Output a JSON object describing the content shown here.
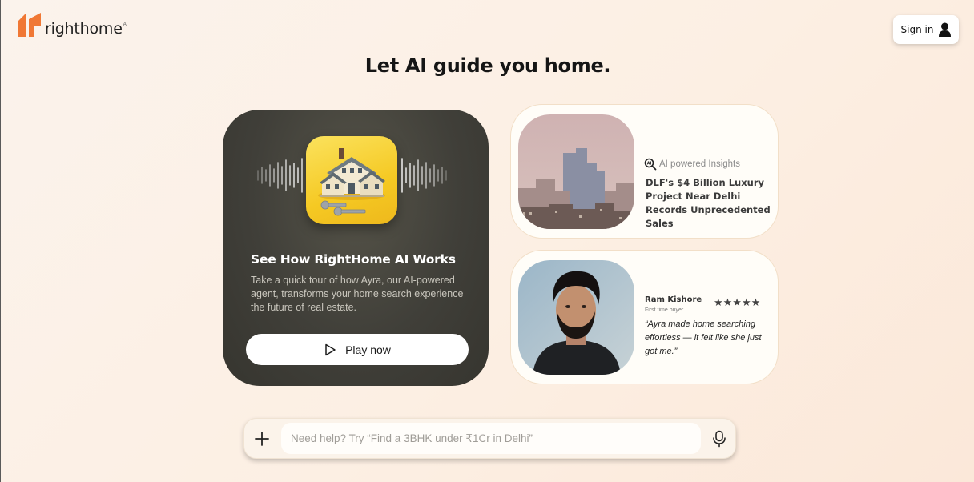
{
  "brand": {
    "name": "righthome",
    "tm": "AI",
    "logo_icon": "righthome-logo-icon",
    "accent": "#f07835"
  },
  "header": {
    "signin_label": "Sign in",
    "signin_icon": "user-icon"
  },
  "hero": {
    "headline": "Let AI guide you home."
  },
  "promo": {
    "title": "See How RightHome AI Works",
    "description": "Take a quick tour of how Ayra, our AI-powered agent, transforms your home search experience the future of real estate.",
    "button_label": "Play now",
    "button_icon": "play-icon",
    "background": "#403f39"
  },
  "news_card": {
    "tag": "AI powered Insights",
    "tag_icon": "ai-search-icon",
    "title": "DLF's $4 Billion Luxury Project Near Delhi Records Unprecedented Sales"
  },
  "review_card": {
    "name": "Ram Kishore",
    "role": "First time buyer",
    "stars": "★★★★★",
    "rating": 5,
    "quote": "“Ayra made home searching effortless — it felt like she just got me.”"
  },
  "chat": {
    "placeholder": "Need help? Try “Find a 3BHK under ₹1Cr in Delhi”",
    "value": "",
    "plus_icon": "plus-icon",
    "mic_icon": "mic-icon"
  }
}
